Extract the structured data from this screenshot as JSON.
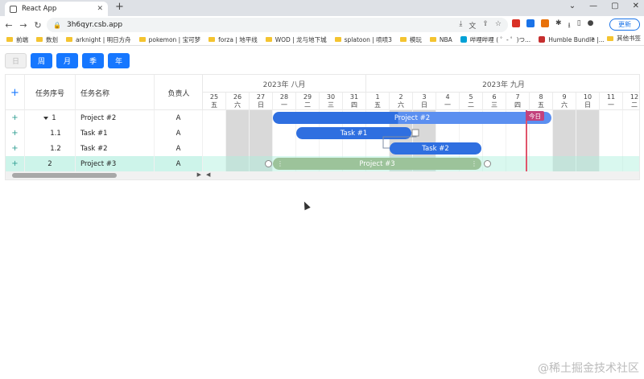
{
  "browser": {
    "tab_title": "React App",
    "new_tab_symbol": "+",
    "address": "3h6qyr.csb.app",
    "update_label": "更新",
    "bookmarks": [
      {
        "label": "前端",
        "kind": "folder"
      },
      {
        "label": "数划",
        "kind": "folder"
      },
      {
        "label": "arknight | 明日方舟",
        "kind": "folder"
      },
      {
        "label": "pokemon | 宝可梦",
        "kind": "folder"
      },
      {
        "label": "forza | 地平线",
        "kind": "folder"
      },
      {
        "label": "WOD | 龙与地下城",
        "kind": "folder"
      },
      {
        "label": "splatoon | 喷喷3",
        "kind": "folder"
      },
      {
        "label": "模玩",
        "kind": "folder"
      },
      {
        "label": "NBA",
        "kind": "folder"
      },
      {
        "label": "哔哩哔哩 ( ゜- ゜)つ...",
        "kind": "site"
      },
      {
        "label": "Humble Bundle |...",
        "kind": "site"
      }
    ],
    "bookmarks_more": "»",
    "other_bookmarks": "其他书签"
  },
  "toolbar": {
    "views": [
      {
        "label": "日",
        "disabled": true
      },
      {
        "label": "周",
        "disabled": false
      },
      {
        "label": "月",
        "disabled": false
      },
      {
        "label": "季",
        "disabled": false
      },
      {
        "label": "年",
        "disabled": false
      }
    ]
  },
  "table": {
    "headers": {
      "add": "+",
      "seq": "任务序号",
      "name": "任务名称",
      "owner": "负责人"
    },
    "rows": [
      {
        "add": "+",
        "seq": "1",
        "name": "Project #2",
        "owner": "A",
        "expandable": true,
        "selected": false
      },
      {
        "add": "+",
        "seq": "1.1",
        "name": "Task #1",
        "owner": "A",
        "expandable": false,
        "selected": false
      },
      {
        "add": "+",
        "seq": "1.2",
        "name": "Task #2",
        "owner": "A",
        "expandable": false,
        "selected": false
      },
      {
        "add": "+",
        "seq": "2",
        "name": "Project #3",
        "owner": "A",
        "expandable": false,
        "selected": true
      }
    ]
  },
  "timeline": {
    "months": [
      "2023年 八月",
      "2023年 九月"
    ],
    "days": [
      {
        "d": "25",
        "w": "五"
      },
      {
        "d": "26",
        "w": "六"
      },
      {
        "d": "27",
        "w": "日"
      },
      {
        "d": "28",
        "w": "一"
      },
      {
        "d": "29",
        "w": "二"
      },
      {
        "d": "30",
        "w": "三"
      },
      {
        "d": "31",
        "w": "四"
      },
      {
        "d": "1",
        "w": "五"
      },
      {
        "d": "2",
        "w": "六"
      },
      {
        "d": "3",
        "w": "日"
      },
      {
        "d": "4",
        "w": "一"
      },
      {
        "d": "5",
        "w": "二"
      },
      {
        "d": "6",
        "w": "三"
      },
      {
        "d": "7",
        "w": "四"
      },
      {
        "d": "8",
        "w": "五"
      },
      {
        "d": "9",
        "w": "六"
      },
      {
        "d": "10",
        "w": "日"
      },
      {
        "d": "11",
        "w": "一"
      },
      {
        "d": "12",
        "w": "二"
      }
    ],
    "today_label": "今日",
    "bars": [
      {
        "label": "Project #2",
        "start": "28",
        "end": "8",
        "style": "proj2"
      },
      {
        "label": "Task #1",
        "start": "29",
        "end": "2",
        "style": "blue"
      },
      {
        "label": "Task #2",
        "start": "2",
        "end": "5",
        "style": "blue"
      },
      {
        "label": "Project #3",
        "start": "28",
        "end": "5",
        "style": "green"
      }
    ]
  },
  "watermark": "@稀土掘金技术社区"
}
